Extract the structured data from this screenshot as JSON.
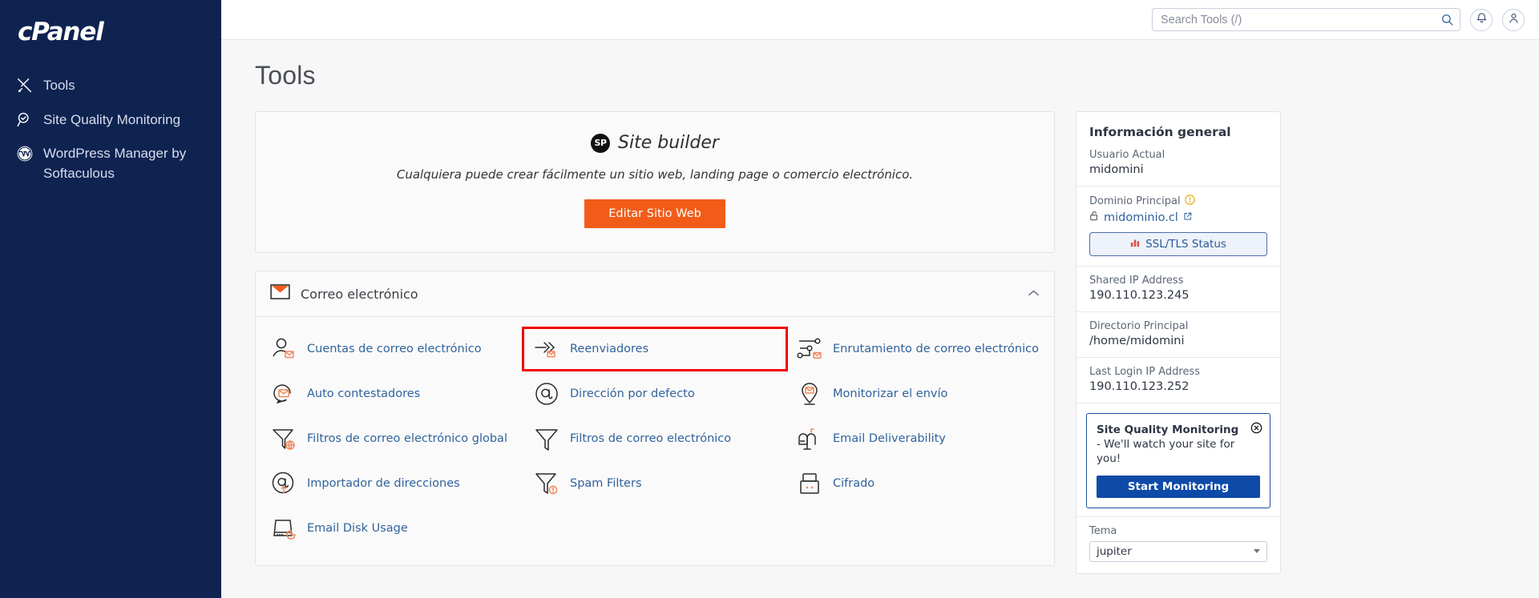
{
  "sidebar": {
    "brand": "cPanel",
    "items": [
      {
        "label": "Tools",
        "icon": "tools-icon"
      },
      {
        "label": "Site Quality Monitoring",
        "icon": "magnifier-check-icon"
      },
      {
        "label": "WordPress Manager by Softaculous",
        "icon": "wordpress-icon"
      }
    ]
  },
  "topbar": {
    "search_placeholder": "Search Tools (/)",
    "search_value": "",
    "notifications_icon": "bell-icon",
    "account_icon": "user-icon",
    "search_icon": "search-icon"
  },
  "page": {
    "title": "Tools"
  },
  "site_builder": {
    "badge": "SP",
    "title": "Site builder",
    "description": "Cualquiera puede crear fácilmente un sitio web, landing page o comercio electrónico.",
    "button_label": "Editar Sitio Web",
    "button_color": "#f25c19"
  },
  "email_group": {
    "title": "Correo electrónico",
    "group_icon": "envelope-icon",
    "collapse_icon": "chevron-up-icon",
    "highlight_color": "#f20000",
    "tools": [
      {
        "label": "Cuentas de correo electrónico",
        "icon": "email-accounts-icon",
        "highlighted": false
      },
      {
        "label": "Reenviadores",
        "icon": "forwarders-icon",
        "highlighted": true
      },
      {
        "label": "Enrutamiento de correo electrónico",
        "icon": "email-routing-icon",
        "highlighted": false
      },
      {
        "label": "Auto contestadores",
        "icon": "autoresponders-icon",
        "highlighted": false
      },
      {
        "label": "Dirección por defecto",
        "icon": "default-address-icon",
        "highlighted": false
      },
      {
        "label": "Monitorizar el envío",
        "icon": "track-delivery-icon",
        "highlighted": false
      },
      {
        "label": "Filtros de correo electrónico global",
        "icon": "global-filters-icon",
        "highlighted": false
      },
      {
        "label": "Filtros de correo electrónico",
        "icon": "email-filters-icon",
        "highlighted": false
      },
      {
        "label": "Email Deliverability",
        "icon": "mailbox-icon",
        "highlighted": false
      },
      {
        "label": "Importador de direcciones",
        "icon": "address-importer-icon",
        "highlighted": false
      },
      {
        "label": "Spam Filters",
        "icon": "spam-filters-icon",
        "highlighted": false
      },
      {
        "label": "Cifrado",
        "icon": "encryption-icon",
        "highlighted": false
      },
      {
        "label": "Email Disk Usage",
        "icon": "disk-usage-icon",
        "highlighted": false
      }
    ]
  },
  "general_info": {
    "heading": "Información general",
    "current_user_label": "Usuario Actual",
    "current_user_value": "midomini",
    "primary_domain_label": "Dominio Principal",
    "primary_domain_warning_icon": "warning-icon",
    "primary_domain_value": "midominio.cl",
    "domain_lock_icon": "unlocked-icon",
    "domain_external_icon": "external-link-icon",
    "ssl_button_label": "SSL/TLS Status",
    "ssl_button_icon": "bar-chart-icon",
    "shared_ip_label": "Shared IP Address",
    "shared_ip_value": "190.110.123.245",
    "home_dir_label": "Directorio Principal",
    "home_dir_value": "/home/midomini",
    "last_login_label": "Last Login IP Address",
    "last_login_value": "190.110.123.252"
  },
  "promo": {
    "title": "Site Quality Monitoring",
    "body": " - We'll watch your site for you!",
    "button_label": "Start Monitoring",
    "close_icon": "close-circle-icon",
    "accent_color": "#0e4aa8"
  },
  "theme": {
    "label": "Tema",
    "value": "jupiter",
    "caret_icon": "caret-down-icon"
  }
}
